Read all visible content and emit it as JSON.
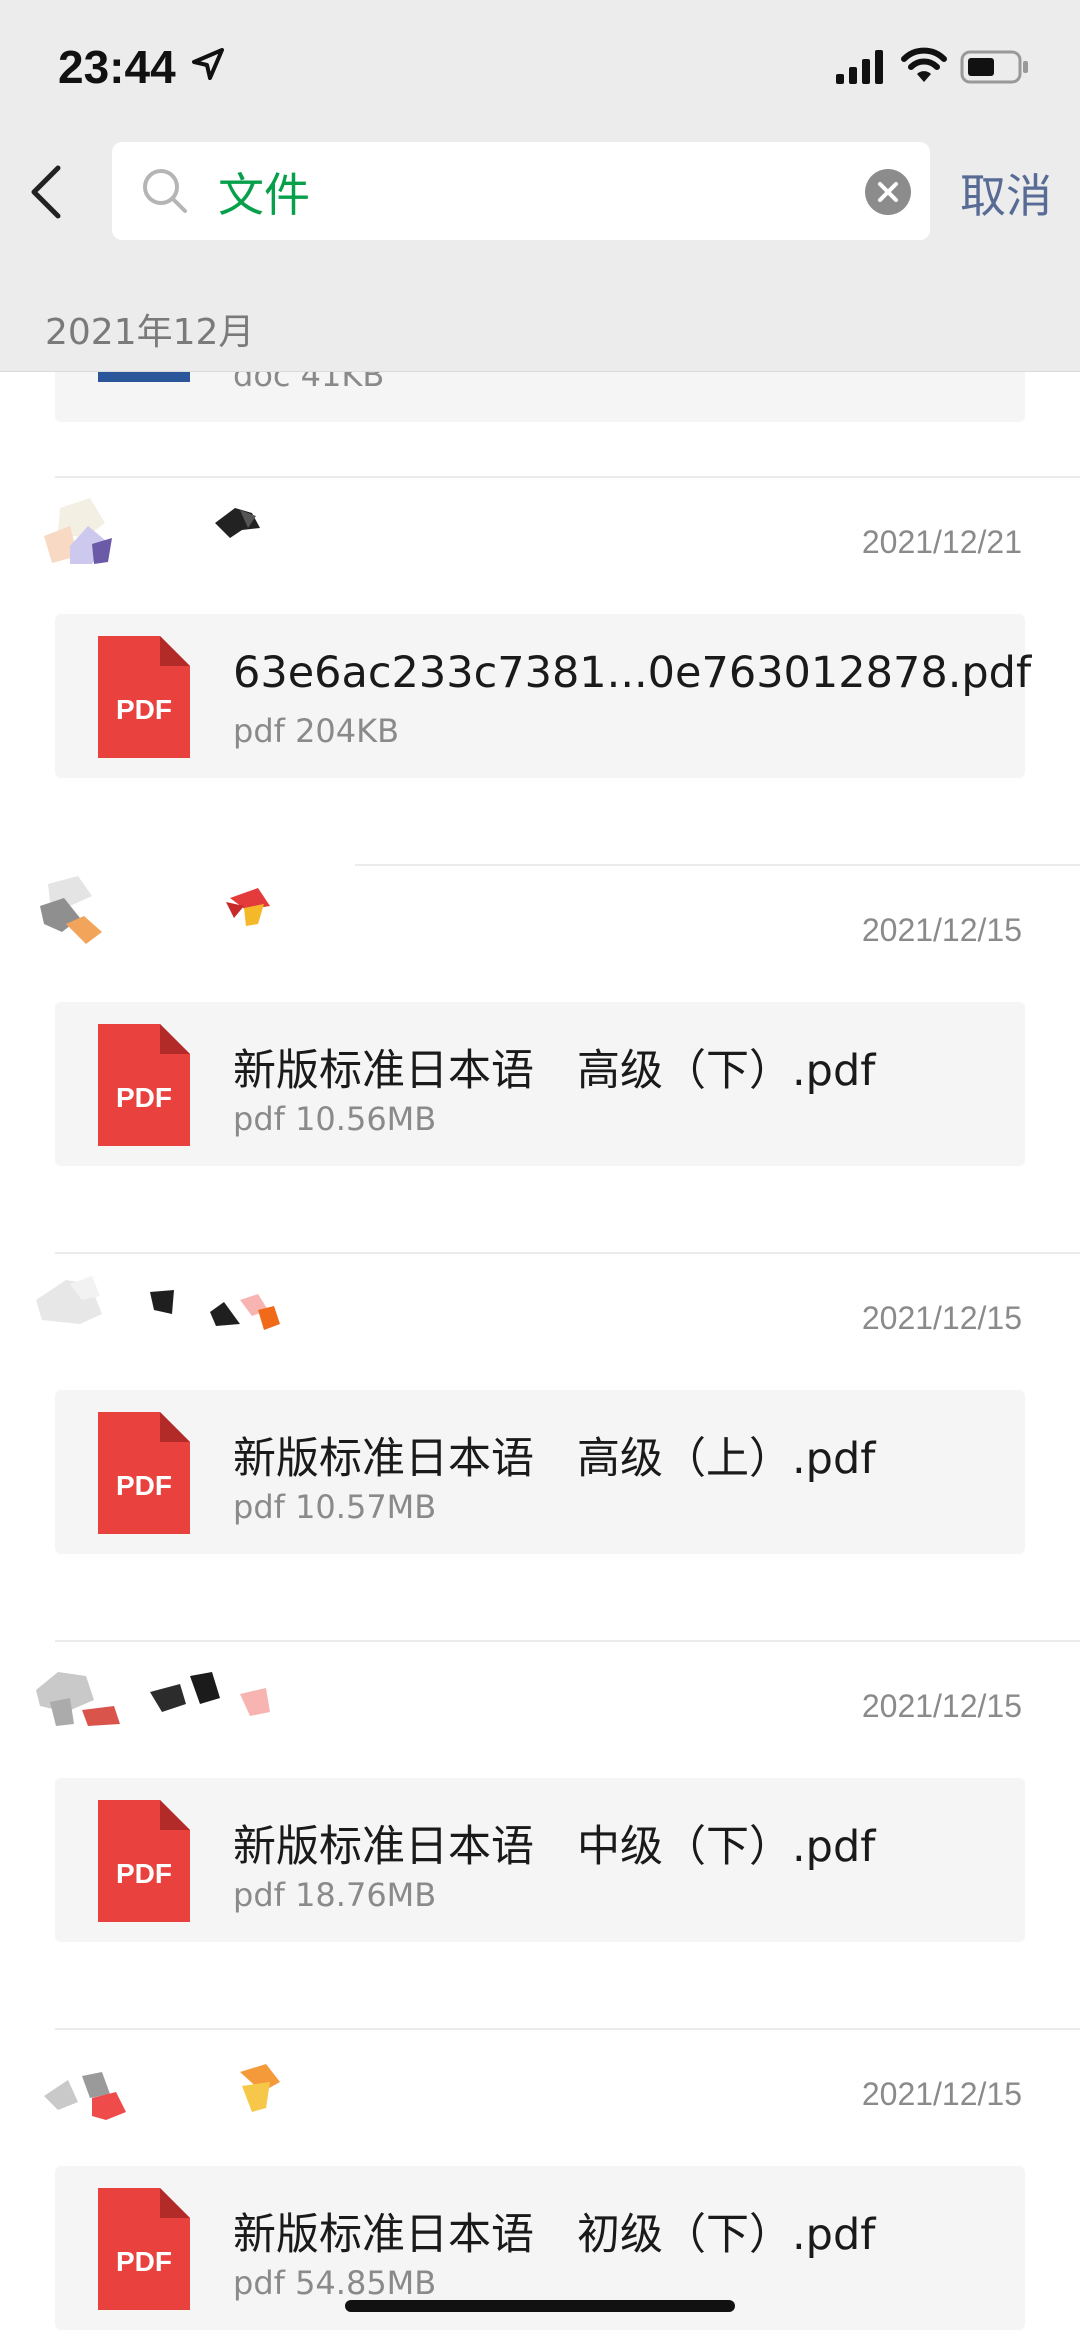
{
  "status_bar": {
    "time": "23:44"
  },
  "search": {
    "query": "文件",
    "cancel_label": "取消"
  },
  "month_header": "2021年12月",
  "partial_item": {
    "meta": "doc 41KB"
  },
  "entries": [
    {
      "date": "2021/12/21",
      "icon_label": "PDF",
      "file_name": "63e6ac233c7381...0e763012878.pdf",
      "meta": "pdf 204KB"
    },
    {
      "date": "2021/12/15",
      "icon_label": "PDF",
      "file_name": "新版标准日本语　高级（下）.pdf",
      "meta": "pdf 10.56MB"
    },
    {
      "date": "2021/12/15",
      "icon_label": "PDF",
      "file_name": "新版标准日本语　高级（上）.pdf",
      "meta": "pdf 10.57MB"
    },
    {
      "date": "2021/12/15",
      "icon_label": "PDF",
      "file_name": "新版标准日本语　中级（下）.pdf",
      "meta": "pdf 18.76MB"
    },
    {
      "date": "2021/12/15",
      "icon_label": "PDF",
      "file_name": "新版标准日本语　初级（下）.pdf",
      "meta": "pdf 54.85MB"
    }
  ],
  "colors": {
    "accent_green": "#07a04a",
    "link_blue": "#576b95",
    "pdf_red": "#e8413e",
    "doc_blue": "#2b579a"
  }
}
